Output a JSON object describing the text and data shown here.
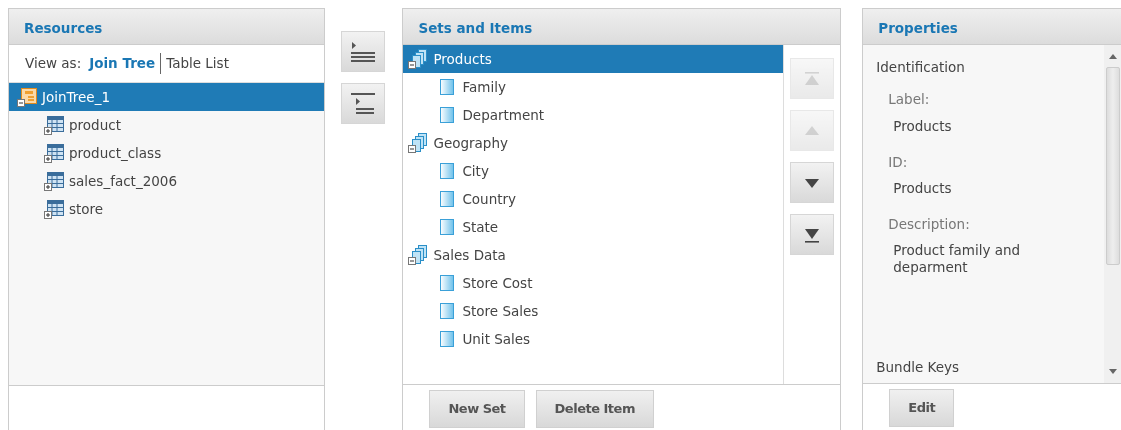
{
  "resources": {
    "title": "Resources",
    "view_as_label": "View as:",
    "view_options": [
      {
        "label": "Join Tree",
        "selected": true
      },
      {
        "label": "Table List",
        "selected": false
      }
    ],
    "tree": [
      {
        "label": "JoinTree_1",
        "kind": "join",
        "selected": true,
        "expanded": true,
        "children": [
          {
            "label": "product",
            "kind": "table",
            "selected": false
          },
          {
            "label": "product_class",
            "kind": "table",
            "selected": false
          },
          {
            "label": "sales_fact_2006",
            "kind": "table",
            "selected": false
          },
          {
            "label": "store",
            "kind": "table",
            "selected": false
          }
        ]
      }
    ]
  },
  "sets": {
    "title": "Sets and Items",
    "items": [
      {
        "label": "Products",
        "selected": true,
        "expanded": true,
        "children": [
          {
            "label": "Family",
            "selected": false
          },
          {
            "label": "Department",
            "selected": false
          }
        ]
      },
      {
        "label": "Geography",
        "selected": false,
        "expanded": true,
        "children": [
          {
            "label": "City",
            "selected": false
          },
          {
            "label": "Country",
            "selected": false
          },
          {
            "label": "State",
            "selected": false
          }
        ]
      },
      {
        "label": "Sales Data",
        "selected": false,
        "expanded": true,
        "children": [
          {
            "label": "Store Cost",
            "selected": false
          },
          {
            "label": "Store Sales",
            "selected": false
          },
          {
            "label": "Unit Sales",
            "selected": false
          }
        ]
      }
    ],
    "order_buttons": [
      {
        "kind": "top",
        "disabled": true
      },
      {
        "kind": "up",
        "disabled": true
      },
      {
        "kind": "down",
        "disabled": false
      },
      {
        "kind": "bottom",
        "disabled": false
      }
    ],
    "buttons": [
      "New Set",
      "Delete Item"
    ]
  },
  "properties": {
    "title": "Properties",
    "section": "Identification",
    "fields": [
      {
        "label": "Label:",
        "value": "Products"
      },
      {
        "label": "ID:",
        "value": "Products"
      },
      {
        "label": "Description:",
        "value": "Product family and deparment"
      }
    ],
    "next_section": "Bundle Keys",
    "buttons": [
      "Edit"
    ]
  }
}
